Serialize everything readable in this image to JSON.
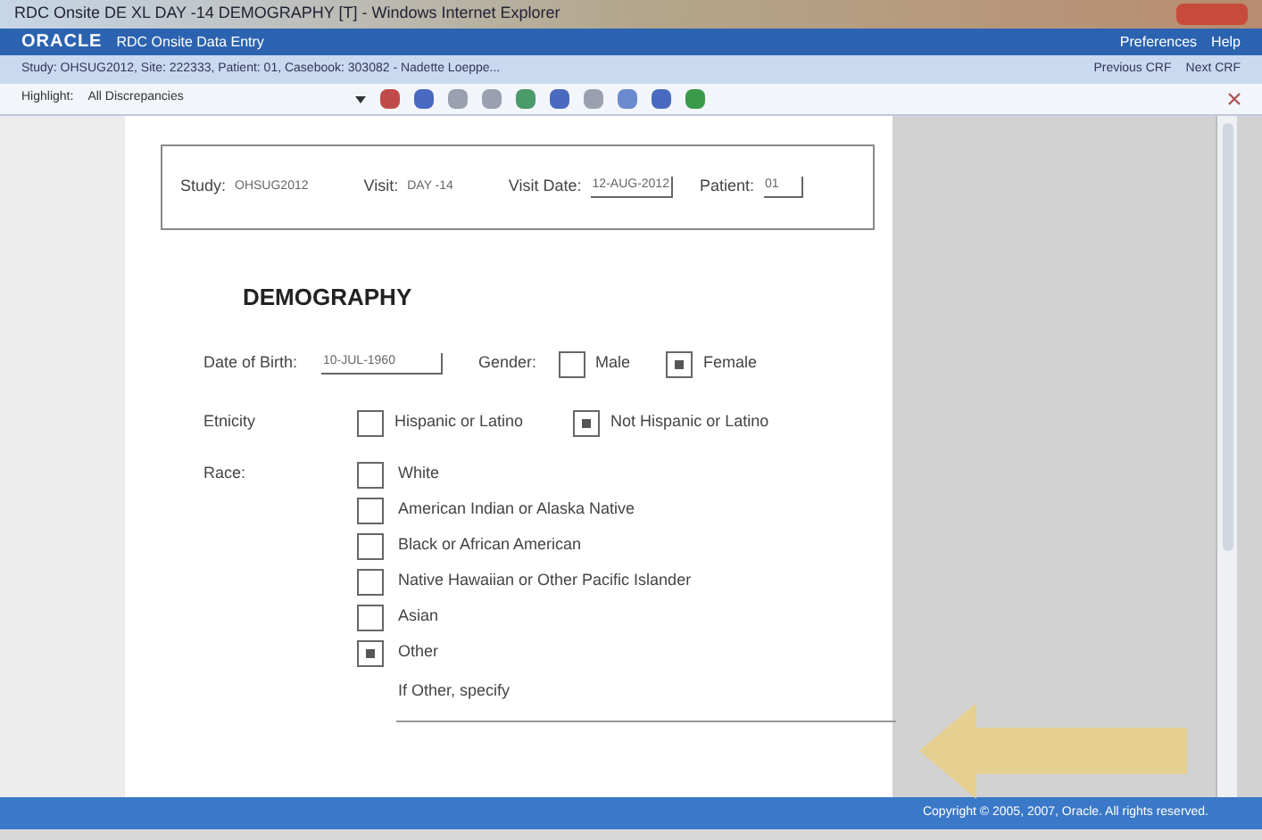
{
  "window": {
    "title": "RDC Onsite DE XL DAY -14 DEMOGRAPHY [T] - Windows Internet Explorer"
  },
  "app_header": {
    "logo": "ORACLE",
    "app_name": "RDC Onsite Data Entry",
    "links": [
      "Preferences",
      "Help"
    ]
  },
  "context_bar": {
    "text": "Study: OHSUG2012, Site: 222333, Patient: 01, Casebook: 303082 - Nadette Loeppe...",
    "links": [
      "Previous CRF",
      "Next CRF"
    ]
  },
  "toolbar": {
    "label": "Highlight:",
    "value": "All Discrepancies"
  },
  "form_header": {
    "study_label": "Study:",
    "study": "OHSUG2012",
    "visit_label": "Visit:",
    "visit": "DAY -14",
    "visit_date_label": "Visit Date:",
    "visit_date": "12-AUG-2012",
    "patient_label": "Patient:",
    "patient": "01"
  },
  "form": {
    "title": "DEMOGRAPHY",
    "dob_label": "Date of Birth:",
    "dob": "10-JUL-1960",
    "gender_label": "Gender:",
    "gender": [
      {
        "label": "Male",
        "checked": false
      },
      {
        "label": "Female",
        "checked": true
      }
    ],
    "ethnicity_label": "Etnicity",
    "ethnicity": [
      {
        "label": "Hispanic or Latino",
        "checked": false
      },
      {
        "label": "Not Hispanic or Latino",
        "checked": true
      }
    ],
    "race_label": "Race:",
    "race": [
      {
        "label": "White",
        "checked": false
      },
      {
        "label": "American Indian or Alaska Native",
        "checked": false
      },
      {
        "label": "Black or African American",
        "checked": false
      },
      {
        "label": "Native Hawaiian or Other Pacific Islander",
        "checked": false
      },
      {
        "label": "Asian",
        "checked": false
      },
      {
        "label": "Other",
        "checked": true
      }
    ],
    "other_specify": "If Other, specify"
  },
  "footer": {
    "copyright": "Copyright © 2005, 2007, Oracle. All rights reserved."
  }
}
